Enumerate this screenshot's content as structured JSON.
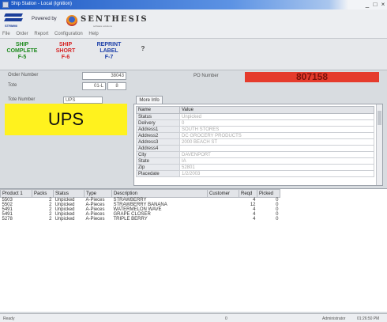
{
  "window": {
    "title": "Ship Station - Local (Ignition)",
    "minimize": "_",
    "maximize": "□",
    "close": "×"
  },
  "logo": {
    "company_subtitle": "STRMMI",
    "powered_by": "Powered by",
    "brand": "SENTHESIS",
    "brand_tagline": "software solutions"
  },
  "menu": [
    "File",
    "Order",
    "Report",
    "Configuration",
    "Help"
  ],
  "toolbar": {
    "buttons": [
      {
        "line1": "SHIP",
        "line2": "COMPLETE",
        "line3": "F-5",
        "color": "#1e8a1e"
      },
      {
        "line1": "SHIP",
        "line2": "SHORT",
        "line3": "F-6",
        "color": "#d62222"
      },
      {
        "line1": "REPRINT",
        "line2": "LABEL",
        "line3": "F-7",
        "color": "#1c3fa8"
      }
    ],
    "help_label": "?"
  },
  "order": {
    "order_number_label": "Order Number",
    "order_number": "38043",
    "tote_label": "Tote",
    "tote_value": "01-L",
    "tote_extra": "8"
  },
  "po": {
    "label": "PO Number",
    "value": "807158",
    "color": "#e53b2c"
  },
  "trailer": {
    "label": "Tote Number",
    "value": "UPS",
    "input_value": "UPS",
    "badge_color": "#fff21e"
  },
  "more_info": {
    "tab_label": "More Info",
    "headers": [
      "Name",
      "Value"
    ],
    "rows": [
      {
        "name": "Status",
        "value": "Unpicked"
      },
      {
        "name": "Delivery",
        "value": "0"
      },
      {
        "name": "Address1",
        "value": "SOUTH STORES"
      },
      {
        "name": "Address2",
        "value": "DC GROCERY PRODUCTS"
      },
      {
        "name": "Address3",
        "value": "2000 BEACH ST"
      },
      {
        "name": "Address4",
        "value": ""
      },
      {
        "name": "City",
        "value": "DAVENPORT"
      },
      {
        "name": "State",
        "value": "IA"
      },
      {
        "name": "Zip",
        "value": "52801"
      },
      {
        "name": "Placedate",
        "value": "1/2/2003"
      }
    ]
  },
  "lines": {
    "headers": [
      "Product 1",
      "Packs",
      "Status",
      "Type",
      "Description",
      "Customer",
      "Reqd",
      "Picked"
    ],
    "rows": [
      {
        "product": "5503",
        "packs": "2",
        "status": "Unpicked",
        "type": "A-Pieces",
        "description": "STRAWBERRY",
        "customer": "",
        "reqd": "4",
        "picked": "0"
      },
      {
        "product": "5502",
        "packs": "2",
        "status": "Unpicked",
        "type": "A-Pieces",
        "description": "STRAWBERRY BANANA",
        "customer": "",
        "reqd": "12",
        "picked": "0"
      },
      {
        "product": "5491",
        "packs": "2",
        "status": "Unpicked",
        "type": "A-Pieces",
        "description": "WATERMELON WAVE",
        "customer": "",
        "reqd": "4",
        "picked": "0"
      },
      {
        "product": "5491",
        "packs": "2",
        "status": "Unpicked",
        "type": "A-Pieces",
        "description": "GRAPE CLOSER",
        "customer": "",
        "reqd": "4",
        "picked": "0"
      },
      {
        "product": "5278",
        "packs": "2",
        "status": "Unpicked",
        "type": "A-Pieces",
        "description": "TRIPLE BERRY",
        "customer": "",
        "reqd": "4",
        "picked": "0"
      }
    ]
  },
  "status": {
    "left": "Ready",
    "middle": "0",
    "user": "Administrator",
    "time": "01:26:50 PM"
  }
}
